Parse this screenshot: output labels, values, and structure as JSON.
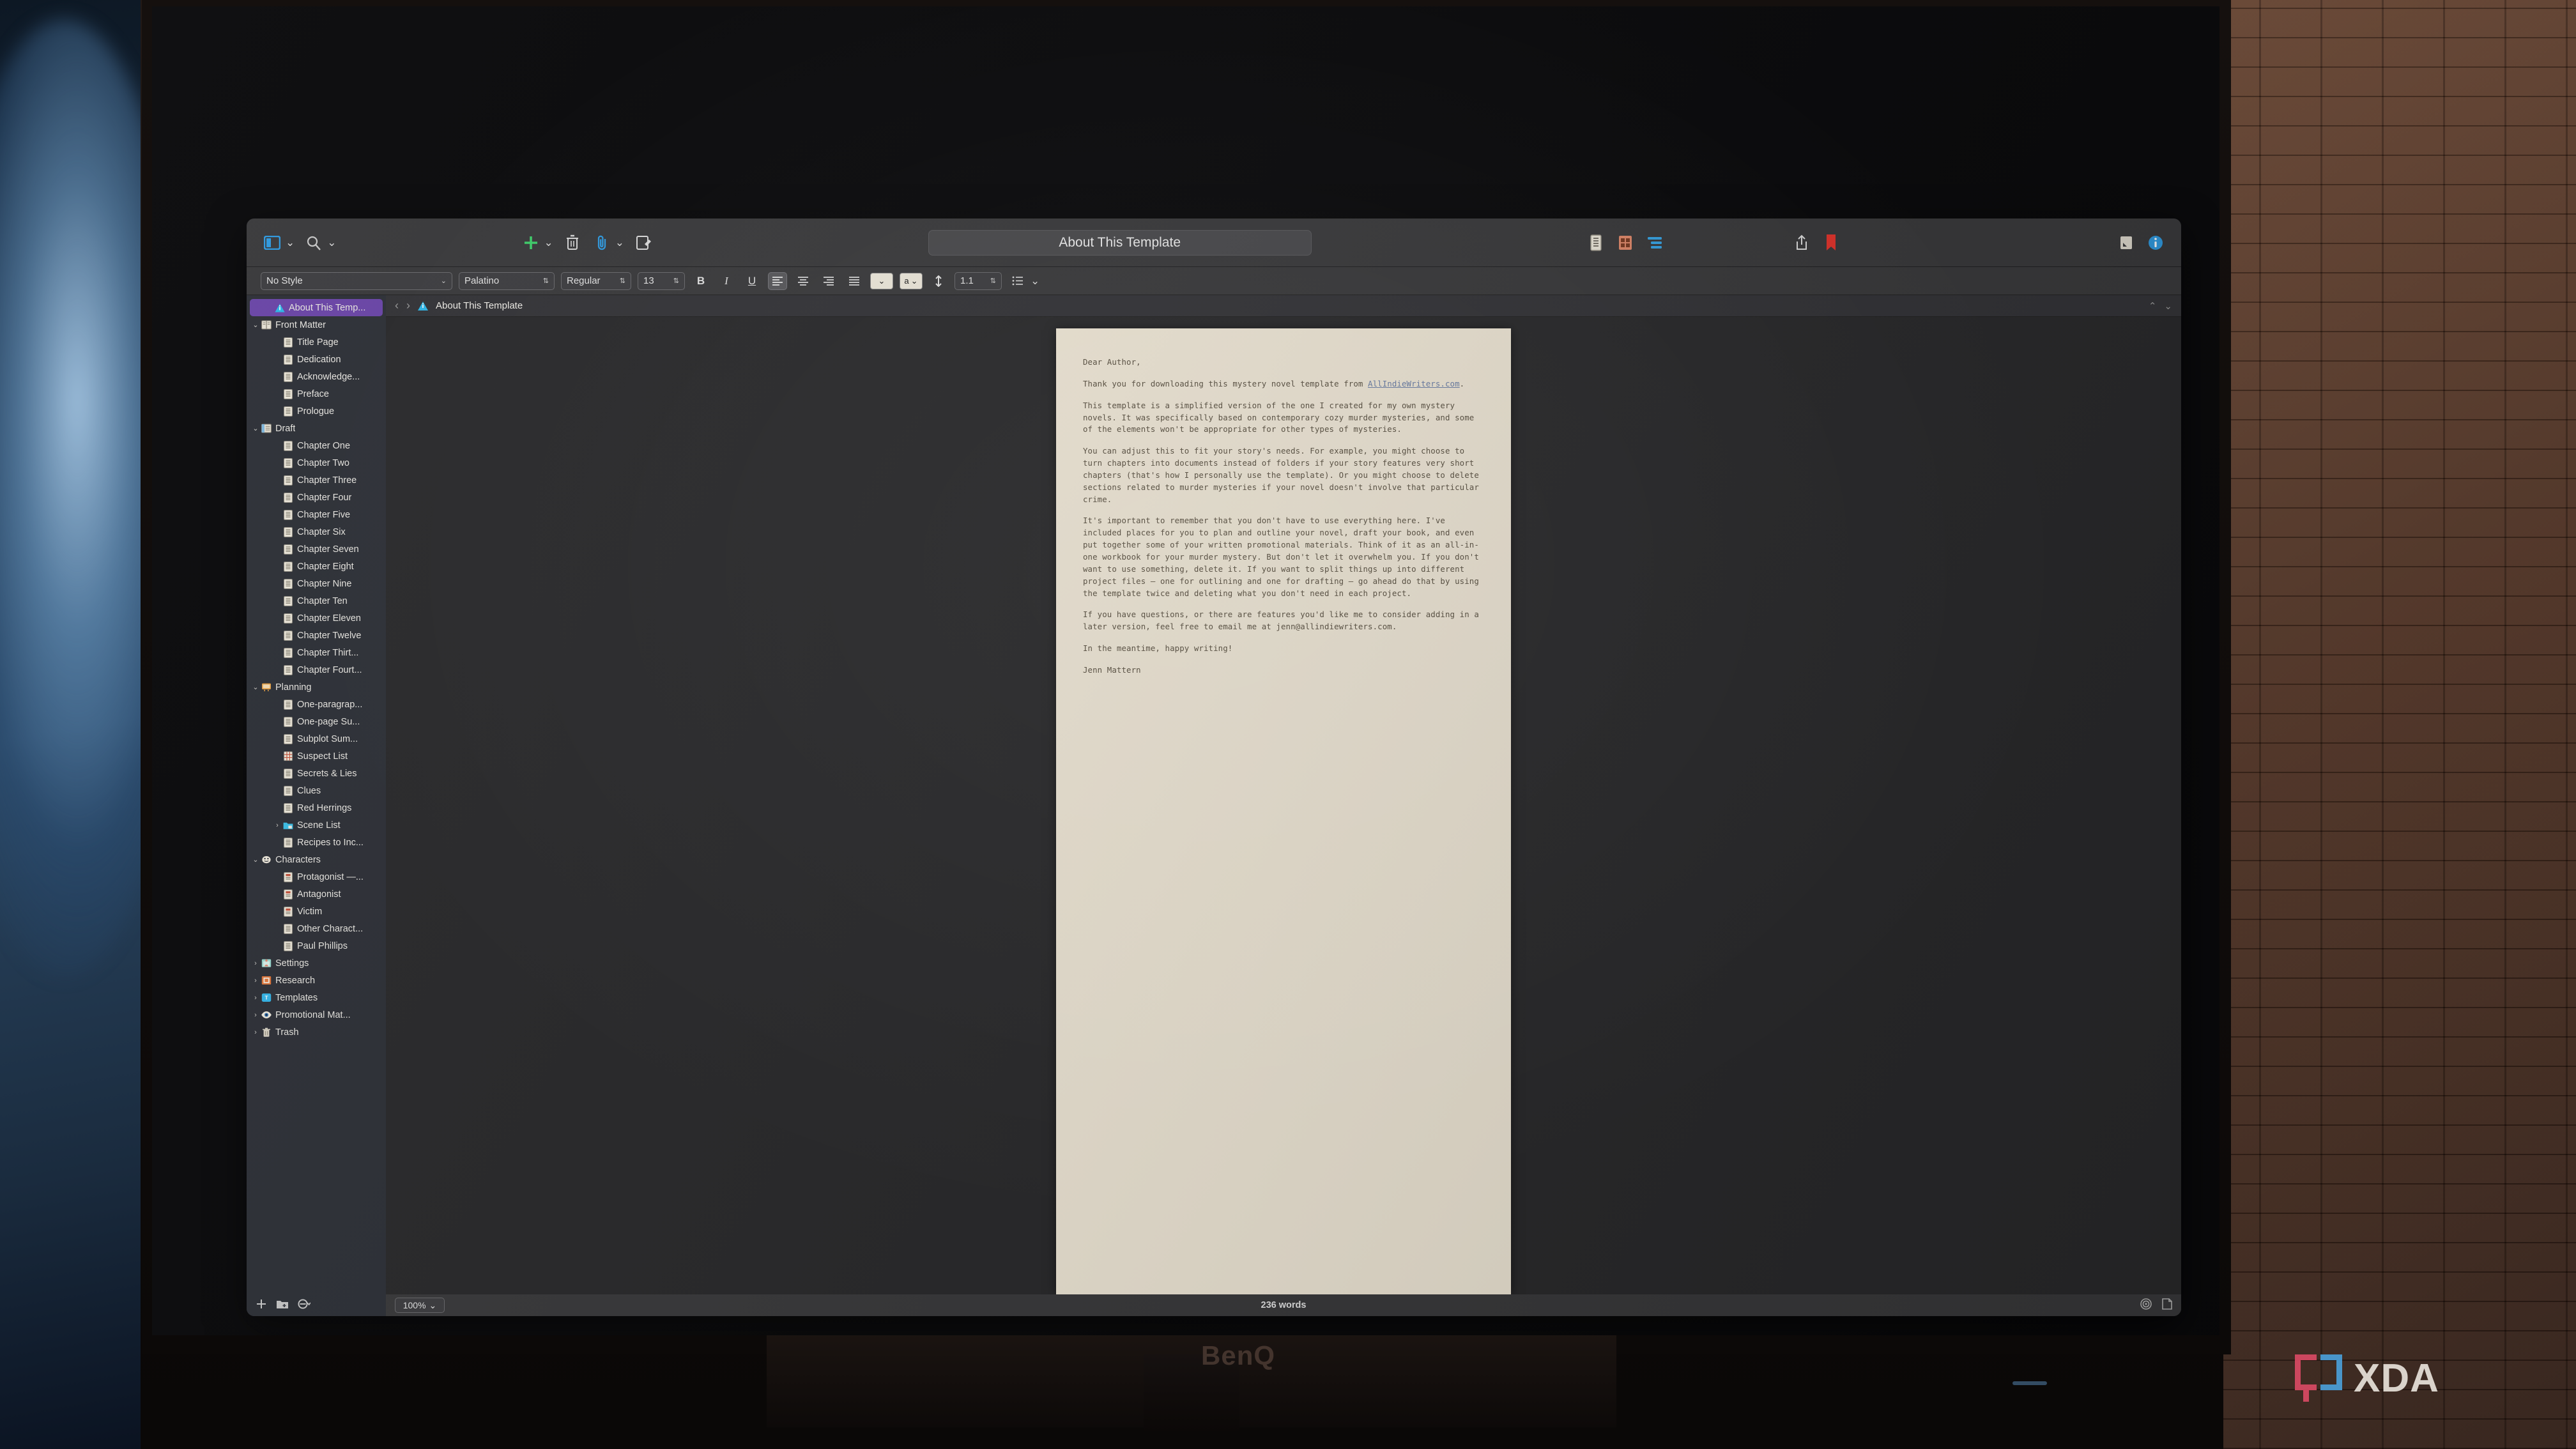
{
  "scene": {
    "monitor_brand": "BenQ",
    "watermark": "XDA"
  },
  "window": {
    "title": "About This Template"
  },
  "toolbar": {
    "view_toggle": "sidebar-toggle",
    "search": "search",
    "add": "add",
    "trash": "trash",
    "attach": "attach",
    "compose": "compose",
    "view_scrivenings": "scrivenings-view",
    "view_corkboard": "corkboard-view",
    "view_outline": "outline-view",
    "share": "share",
    "bookmark": "bookmark",
    "quick_reference": "quick-reference",
    "inspector": "inspector"
  },
  "formatbar": {
    "style": "No Style",
    "font": "Palatino",
    "weight": "Regular",
    "size": "13",
    "bold": "B",
    "italic": "I",
    "underline": "U",
    "highlight_glyph": "a",
    "line_height": "1.1"
  },
  "editor_header": {
    "back": "‹",
    "forward": "›",
    "doc_title": "About This Template",
    "collapse_up": "⌃",
    "collapse_down": "⌄"
  },
  "document": {
    "paragraphs": [
      "Dear Author,",
      "Thank you for downloading this mystery novel template from ",
      "This template is a simplified version of the one I created for my own mystery novels. It was specifically based on contemporary cozy murder mysteries, and some of the elements won't be appropriate for other types of mysteries.",
      "You can adjust this to fit your story's needs. For example, you might choose to turn chapters into documents instead of folders if your story features very short chapters (that's how I personally use the template). Or you might choose to delete sections related to murder mysteries if your novel doesn't involve that particular crime.",
      "It's important to remember that you don't have to use everything here. I've included places for you to plan and outline your novel, draft your book, and even put together some of your written promotional materials. Think of it as an all-in-one workbook for your murder mystery. But don't let it overwhelm you. If you don't want to use something, delete it. If you want to split things up into different project files — one for outlining and one for drafting — go ahead do that by using the template twice and deleting what you don't need in each project.",
      "If you have questions, or there are features you'd like me to consider adding in a later version, feel free to email me at jenn@allindiewriters.com.",
      "In the meantime, happy writing!",
      "Jenn Mattern"
    ],
    "link_text": "AllIndieWriters.com",
    "link_suffix": "."
  },
  "footer": {
    "add_label": "+",
    "new_folder_label": "new-folder",
    "filter_label": "filter",
    "zoom": "100%",
    "word_count": "236 words"
  },
  "binder": {
    "items": [
      {
        "label": "About This Temp...",
        "depth": 1,
        "icon": "info-doc",
        "selected": true,
        "disclosure": ""
      },
      {
        "label": "Front Matter",
        "depth": 0,
        "icon": "folder-book",
        "selected": false,
        "disclosure": "⌄"
      },
      {
        "label": "Title Page",
        "depth": 2,
        "icon": "doc",
        "selected": false,
        "disclosure": ""
      },
      {
        "label": "Dedication",
        "depth": 2,
        "icon": "doc",
        "selected": false,
        "disclosure": ""
      },
      {
        "label": "Acknowledge...",
        "depth": 2,
        "icon": "doc",
        "selected": false,
        "disclosure": ""
      },
      {
        "label": "Preface",
        "depth": 2,
        "icon": "doc",
        "selected": false,
        "disclosure": ""
      },
      {
        "label": "Prologue",
        "depth": 2,
        "icon": "doc",
        "selected": false,
        "disclosure": ""
      },
      {
        "label": "Draft",
        "depth": 0,
        "icon": "folder-draft",
        "selected": false,
        "disclosure": "⌄"
      },
      {
        "label": "Chapter One",
        "depth": 2,
        "icon": "doc",
        "selected": false,
        "disclosure": ""
      },
      {
        "label": "Chapter Two",
        "depth": 2,
        "icon": "doc",
        "selected": false,
        "disclosure": ""
      },
      {
        "label": "Chapter Three",
        "depth": 2,
        "icon": "doc",
        "selected": false,
        "disclosure": ""
      },
      {
        "label": "Chapter Four",
        "depth": 2,
        "icon": "doc",
        "selected": false,
        "disclosure": ""
      },
      {
        "label": "Chapter Five",
        "depth": 2,
        "icon": "doc",
        "selected": false,
        "disclosure": ""
      },
      {
        "label": "Chapter Six",
        "depth": 2,
        "icon": "doc",
        "selected": false,
        "disclosure": ""
      },
      {
        "label": "Chapter Seven",
        "depth": 2,
        "icon": "doc",
        "selected": false,
        "disclosure": ""
      },
      {
        "label": "Chapter Eight",
        "depth": 2,
        "icon": "doc",
        "selected": false,
        "disclosure": ""
      },
      {
        "label": "Chapter Nine",
        "depth": 2,
        "icon": "doc",
        "selected": false,
        "disclosure": ""
      },
      {
        "label": "Chapter Ten",
        "depth": 2,
        "icon": "doc",
        "selected": false,
        "disclosure": ""
      },
      {
        "label": "Chapter Eleven",
        "depth": 2,
        "icon": "doc",
        "selected": false,
        "disclosure": ""
      },
      {
        "label": "Chapter Twelve",
        "depth": 2,
        "icon": "doc",
        "selected": false,
        "disclosure": ""
      },
      {
        "label": "Chapter Thirt...",
        "depth": 2,
        "icon": "doc",
        "selected": false,
        "disclosure": ""
      },
      {
        "label": "Chapter Fourt...",
        "depth": 2,
        "icon": "doc",
        "selected": false,
        "disclosure": ""
      },
      {
        "label": "Planning",
        "depth": 0,
        "icon": "folder-planning",
        "selected": false,
        "disclosure": "⌄"
      },
      {
        "label": "One-paragrap...",
        "depth": 2,
        "icon": "doc",
        "selected": false,
        "disclosure": ""
      },
      {
        "label": "One-page Su...",
        "depth": 2,
        "icon": "doc",
        "selected": false,
        "disclosure": ""
      },
      {
        "label": "Subplot Sum...",
        "depth": 2,
        "icon": "doc",
        "selected": false,
        "disclosure": ""
      },
      {
        "label": "Suspect List",
        "depth": 2,
        "icon": "table",
        "selected": false,
        "disclosure": ""
      },
      {
        "label": "Secrets & Lies",
        "depth": 2,
        "icon": "doc",
        "selected": false,
        "disclosure": ""
      },
      {
        "label": "Clues",
        "depth": 2,
        "icon": "doc",
        "selected": false,
        "disclosure": ""
      },
      {
        "label": "Red Herrings",
        "depth": 2,
        "icon": "doc",
        "selected": false,
        "disclosure": ""
      },
      {
        "label": "Scene List",
        "depth": 2,
        "icon": "folder-blue",
        "selected": false,
        "disclosure": "›"
      },
      {
        "label": "Recipes to Inc...",
        "depth": 2,
        "icon": "doc",
        "selected": false,
        "disclosure": ""
      },
      {
        "label": "Characters",
        "depth": 0,
        "icon": "masks",
        "selected": false,
        "disclosure": "⌄"
      },
      {
        "label": "Protagonist —...",
        "depth": 2,
        "icon": "doc-red",
        "selected": false,
        "disclosure": ""
      },
      {
        "label": "Antagonist",
        "depth": 2,
        "icon": "doc-red",
        "selected": false,
        "disclosure": ""
      },
      {
        "label": "Victim",
        "depth": 2,
        "icon": "doc-red",
        "selected": false,
        "disclosure": ""
      },
      {
        "label": "Other Charact...",
        "depth": 2,
        "icon": "doc",
        "selected": false,
        "disclosure": ""
      },
      {
        "label": "Paul Phillips",
        "depth": 2,
        "icon": "doc",
        "selected": false,
        "disclosure": ""
      },
      {
        "label": "Settings",
        "depth": 0,
        "icon": "folder-settings",
        "selected": false,
        "disclosure": "›"
      },
      {
        "label": "Research",
        "depth": 0,
        "icon": "folder-research",
        "selected": false,
        "disclosure": "›"
      },
      {
        "label": "Templates",
        "depth": 0,
        "icon": "folder-templates",
        "selected": false,
        "disclosure": "›"
      },
      {
        "label": "Promotional Mat...",
        "depth": 0,
        "icon": "eye",
        "selected": false,
        "disclosure": "›"
      },
      {
        "label": "Trash",
        "depth": 0,
        "icon": "trash",
        "selected": false,
        "disclosure": "›"
      }
    ]
  },
  "colors": {
    "selection": "#6b46a8",
    "binder_bg": "#2e3138",
    "toolbar_bg": "#3a3a3c",
    "paper": "#f2ead9",
    "accent_green": "#3ecf6a",
    "accent_blue": "#2f9ae0",
    "accent_red": "#e8342c"
  }
}
